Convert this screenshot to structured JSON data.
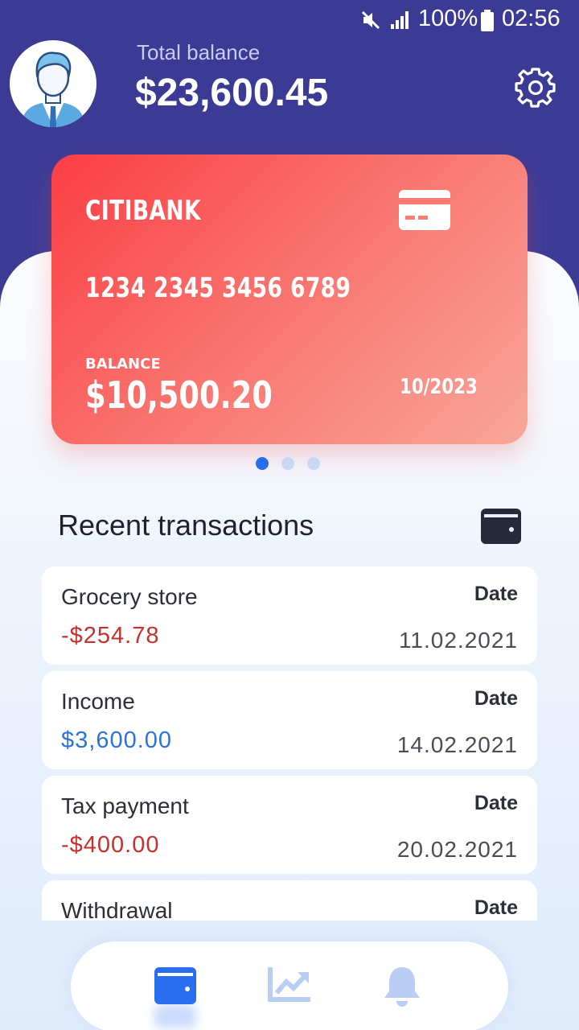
{
  "status_bar": {
    "battery": "100%",
    "time": "02:56"
  },
  "header": {
    "balance_label": "Total balance",
    "balance_value": "$23,600.45"
  },
  "card": {
    "bank": "CITIBANK",
    "number": "1234 2345 3456 6789",
    "balance_label": "BALANCE",
    "balance_value": "$10,500.20",
    "expiry": "10/2023",
    "pages": 3,
    "active_page": 1
  },
  "transactions": {
    "title": "Recent transactions",
    "items": [
      {
        "name": "Grocery store",
        "amount": "-$254.78",
        "date_label": "Date",
        "date": "11.02.2021",
        "type": "debit"
      },
      {
        "name": "Income",
        "amount": "$3,600.00",
        "date_label": "Date",
        "date": "14.02.2021",
        "type": "credit"
      },
      {
        "name": "Tax payment",
        "amount": "-$400.00",
        "date_label": "Date",
        "date": "20.02.2021",
        "type": "debit"
      },
      {
        "name": "Withdrawal",
        "amount": "",
        "date_label": "Date",
        "date": "",
        "type": "debit"
      }
    ]
  },
  "nav": {
    "items": [
      "wallet-icon",
      "chart-icon",
      "bell-icon"
    ],
    "active": "wallet-icon"
  },
  "colors": {
    "header_bg": "#3b3b96",
    "accent": "#2a6ef0",
    "debit": "#c8302e",
    "credit": "#2b72e0"
  }
}
